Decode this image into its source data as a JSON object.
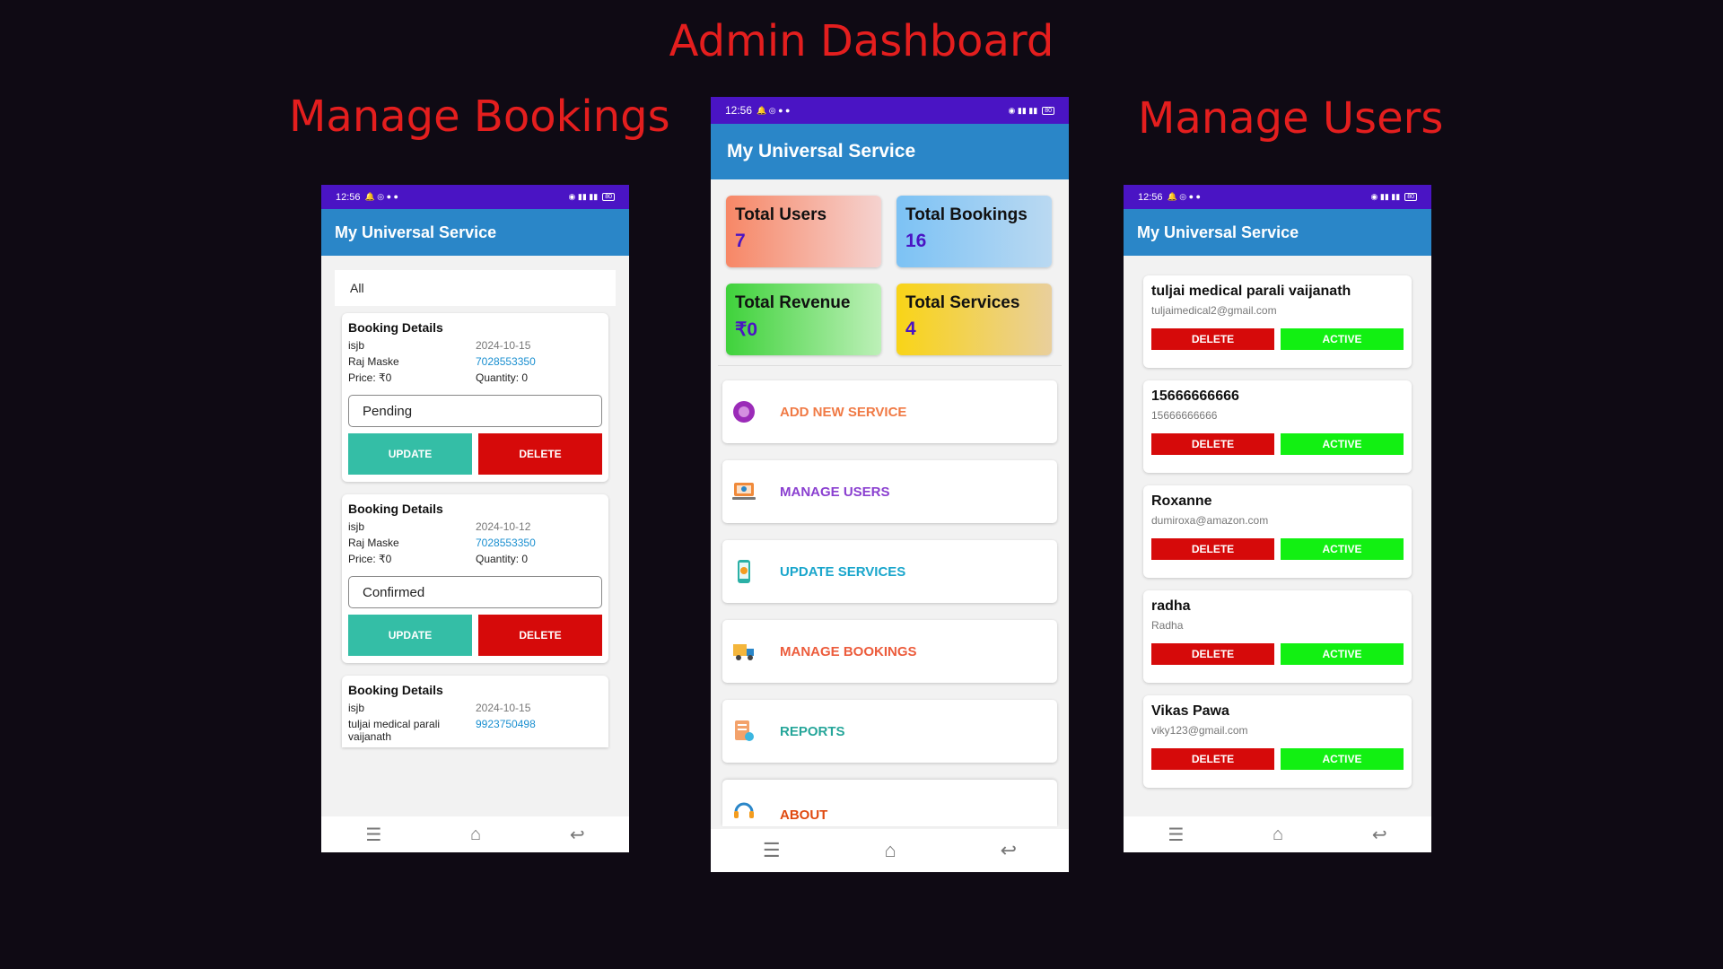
{
  "headings": {
    "center": "Admin Dashboard",
    "left": "Manage Bookings",
    "right": "Manage Users"
  },
  "status_bar": {
    "time": "12:56",
    "battery": "80"
  },
  "app_title": "My Universal Service",
  "bookings_screen": {
    "filter": "All",
    "bookings": [
      {
        "title": "Booking Details",
        "service": "isjb",
        "date": "2024-10-15",
        "customer": "Raj Maske",
        "phone": "7028553350",
        "price": "Price: ₹0",
        "quantity": "Quantity: 0",
        "status": "Pending",
        "update_label": "UPDATE",
        "delete_label": "DELETE"
      },
      {
        "title": "Booking Details",
        "service": "isjb",
        "date": "2024-10-12",
        "customer": "Raj Maske",
        "phone": "7028553350",
        "price": "Price: ₹0",
        "quantity": "Quantity: 0",
        "status": "Confirmed",
        "update_label": "UPDATE",
        "delete_label": "DELETE"
      },
      {
        "title": "Booking Details",
        "service": "isjb",
        "date": "2024-10-15",
        "customer": "tuljai medical parali vaijanath",
        "phone": "9923750498"
      }
    ]
  },
  "dashboard_screen": {
    "stats": [
      {
        "label": "Total Users",
        "value": "7"
      },
      {
        "label": "Total Bookings",
        "value": "16"
      },
      {
        "label": "Total Revenue",
        "value": "₹0"
      },
      {
        "label": "Total Services",
        "value": "4"
      }
    ],
    "menu": [
      {
        "label": "ADD NEW SERVICE",
        "icon": "add-service-icon"
      },
      {
        "label": "MANAGE USERS",
        "icon": "laptop-users-icon"
      },
      {
        "label": "UPDATE SERVICES",
        "icon": "phone-update-icon"
      },
      {
        "label": "MANAGE BOOKINGS",
        "icon": "truck-icon"
      },
      {
        "label": "REPORTS",
        "icon": "reports-icon"
      },
      {
        "label": "ABOUT",
        "icon": "headset-icon"
      }
    ]
  },
  "users_screen": {
    "delete_label": "DELETE",
    "active_label": "ACTIVE",
    "users": [
      {
        "name": "tuljai medical parali vaijanath",
        "email": "tuljaimedical2@gmail.com"
      },
      {
        "name": "15666666666",
        "email": "15666666666"
      },
      {
        "name": "Roxanne",
        "email": "dumiroxa@amazon.com"
      },
      {
        "name": "radha",
        "email": "Radha"
      },
      {
        "name": "Vikas Pawa",
        "email": "viky123@gmail.com"
      }
    ]
  },
  "colors": {
    "heading": "#e41e1e",
    "status_bar": "#4a14c4",
    "app_bar": "#2a86c8",
    "update": "#34bea6",
    "delete": "#d60a0a",
    "active": "#12f012"
  }
}
